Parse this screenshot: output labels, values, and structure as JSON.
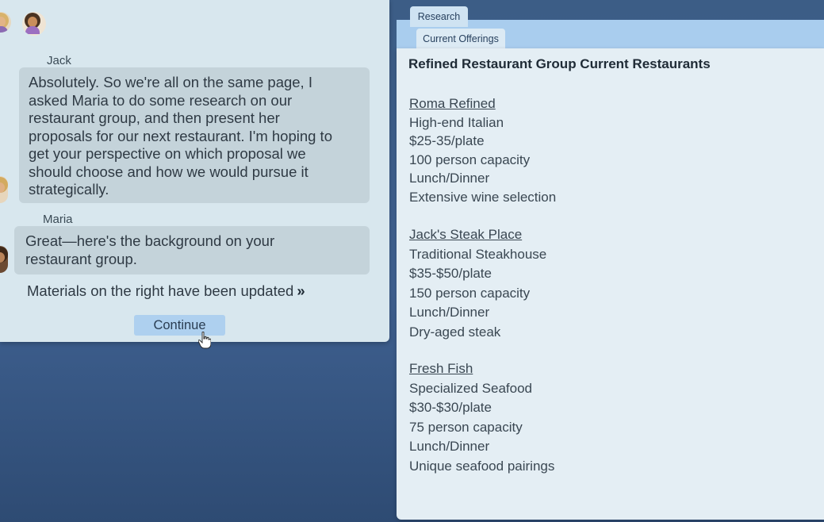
{
  "chat": {
    "messages": [
      {
        "speaker": "Jack",
        "lines": [
          "Absolutely. So we're all on the same page, I",
          "asked Maria to do some research on our",
          "restaurant group, and then present her",
          "proposals for our next restaurant. I'm hoping to",
          "get your perspective on which proposal we",
          "should choose and how we would pursue it",
          "strategically."
        ]
      },
      {
        "speaker": "Maria",
        "lines": [
          "Great—here's the background on your",
          "restaurant group."
        ]
      }
    ],
    "update_note": "Materials on the right have been updated",
    "update_arrows": "»",
    "continue_label": "Continue"
  },
  "research": {
    "tab_label": "Research",
    "subtab_label": "Current Offerings",
    "title": "Refined Restaurant Group Current Restaurants",
    "restaurants": [
      {
        "name": "Roma Refined",
        "details": [
          "High-end Italian",
          "$25-35/plate",
          "100 person capacity",
          "Lunch/Dinner",
          "Extensive wine selection"
        ]
      },
      {
        "name": "Jack's Steak Place",
        "details": [
          "Traditional Steakhouse",
          "$35-$50/plate",
          "150 person capacity",
          "Lunch/Dinner",
          "Dry-aged steak"
        ]
      },
      {
        "name": "Fresh Fish",
        "details": [
          "Specialized Seafood",
          "$30-$30/plate",
          "75 person capacity",
          "Lunch/Dinner",
          "Unique seafood pairings"
        ]
      }
    ]
  },
  "colors": {
    "desktop": "#3f6191",
    "chat_panel": "#d8e7ee",
    "bubble": "#c4d3da",
    "continue_button": "#aed0ef",
    "research_panel": "#e4eef4",
    "subtab_bar": "#a9cdee"
  },
  "icons": {
    "cursor": "hand-pointer-icon",
    "avatars": [
      "jack-avatar-icon",
      "maria-avatar-icon"
    ]
  }
}
